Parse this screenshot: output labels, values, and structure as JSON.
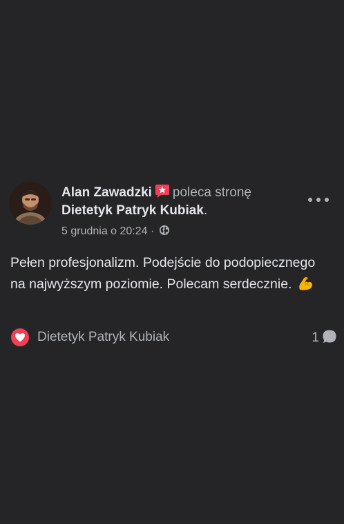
{
  "post": {
    "author": "Alan Zawadzki",
    "recommend_verb": "poleca stronę",
    "page_name": "Dietetyk Patryk Kubiak",
    "page_name_suffix": ".",
    "timestamp": "5 grudnia o 20:24",
    "separator": "·",
    "privacy_icon": "globe-icon",
    "text": "Pełen profesjonalizm. Podejście do podopiecznego na najwyższym poziomie. Polecam serdecznie.",
    "emoji": "flexed-biceps",
    "more_icon": "more-horizontal-icon"
  },
  "footer": {
    "reaction_icon": "love-heart-icon",
    "reactor_name": "Dietetyk Patryk Kubiak",
    "comment_count": "1",
    "comment_icon": "comment-bubble-icon"
  },
  "colors": {
    "background": "#252527",
    "primary_text": "#e4e6eb",
    "secondary_text": "#b0b3b8",
    "recommend_badge": "#f33e58",
    "love_reaction": "#f33e58"
  }
}
